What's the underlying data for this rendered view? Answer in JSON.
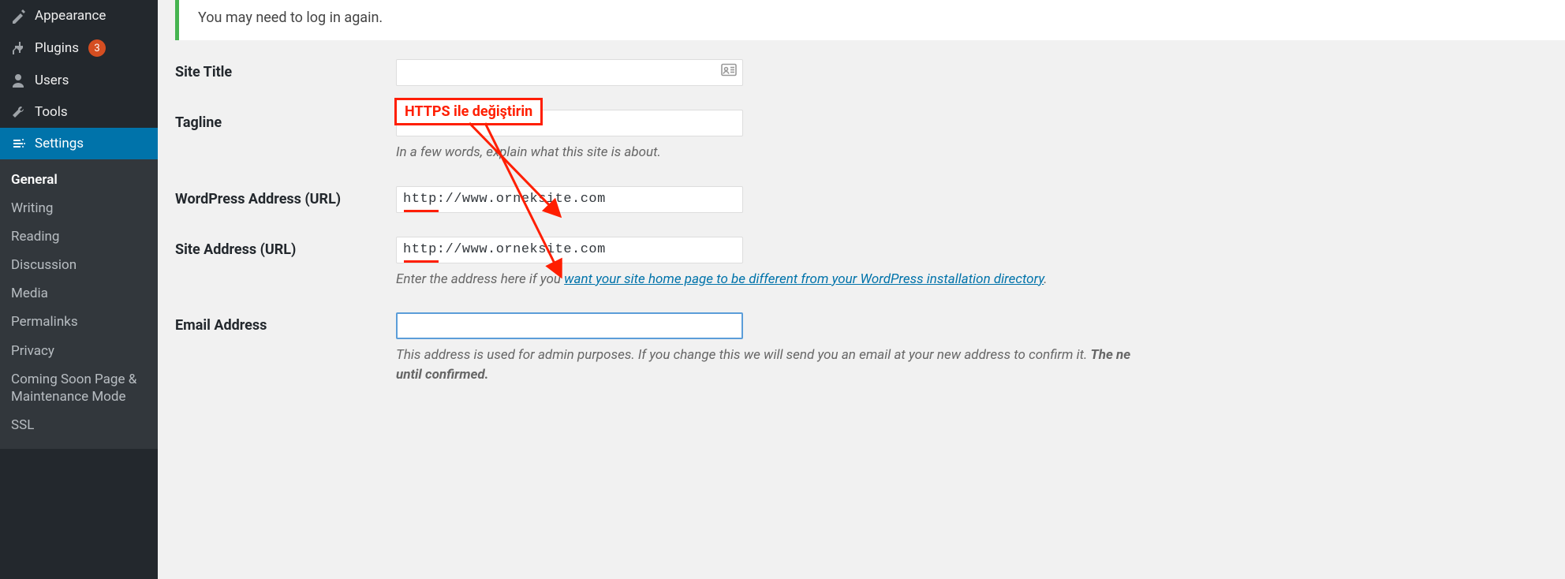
{
  "sidebar": {
    "items": [
      {
        "label": "Appearance",
        "icon": "brush"
      },
      {
        "label": "Plugins",
        "icon": "plug",
        "badge": "3"
      },
      {
        "label": "Users",
        "icon": "user"
      },
      {
        "label": "Tools",
        "icon": "wrench"
      },
      {
        "label": "Settings",
        "icon": "sliders"
      }
    ],
    "submenu": [
      "General",
      "Writing",
      "Reading",
      "Discussion",
      "Media",
      "Permalinks",
      "Privacy",
      "Coming Soon Page & Maintenance Mode",
      "SSL"
    ]
  },
  "notice": "You may need to log in again.",
  "fields": {
    "site_title": {
      "label": "Site Title",
      "value": ""
    },
    "tagline": {
      "label": "Tagline",
      "value": "",
      "description": "In a few words, explain what this site is about."
    },
    "wp_address": {
      "label": "WordPress Address (URL)",
      "value": "http://www.orneksite.com"
    },
    "site_address": {
      "label": "Site Address (URL)",
      "value": "http://www.orneksite.com",
      "desc_prefix": "Enter the address here if you ",
      "desc_link": "want your site home page to be different from your WordPress installation directory",
      "desc_suffix": "."
    },
    "email": {
      "label": "Email Address",
      "value": "",
      "desc_prefix": "This address is used for admin purposes. If you change this we will send you an email at your new address to confirm it. ",
      "desc_strong": "The ne",
      "desc_line2": "until confirmed."
    }
  },
  "annotation": {
    "label": "HTTPS ile değiştirin"
  }
}
